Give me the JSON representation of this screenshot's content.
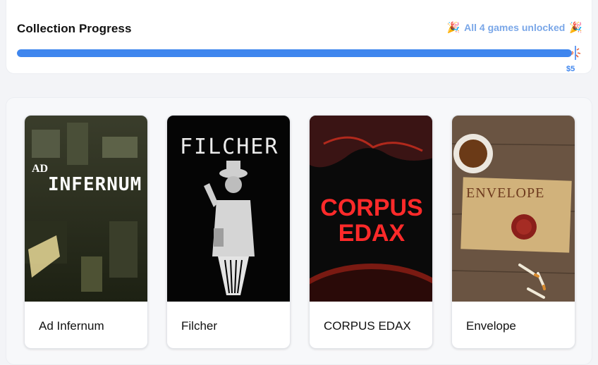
{
  "progress": {
    "title": "Collection Progress",
    "status": "All 4 games unlocked",
    "price_label": "$5",
    "fraction": 1.0,
    "accent_color": "#3f86ee",
    "status_color": "#7aa7e8"
  },
  "games": [
    {
      "name": "Ad Infernum",
      "cover_text_top": "AD",
      "cover_text_main": "INFERNUM"
    },
    {
      "name": "Filcher",
      "cover_text_main": "FILCHER"
    },
    {
      "name": "CORPUS EDAX",
      "cover_text_line1": "CORPUS",
      "cover_text_line2": "EDAX"
    },
    {
      "name": "Envelope",
      "cover_text_main": "ENVELOPE"
    }
  ]
}
